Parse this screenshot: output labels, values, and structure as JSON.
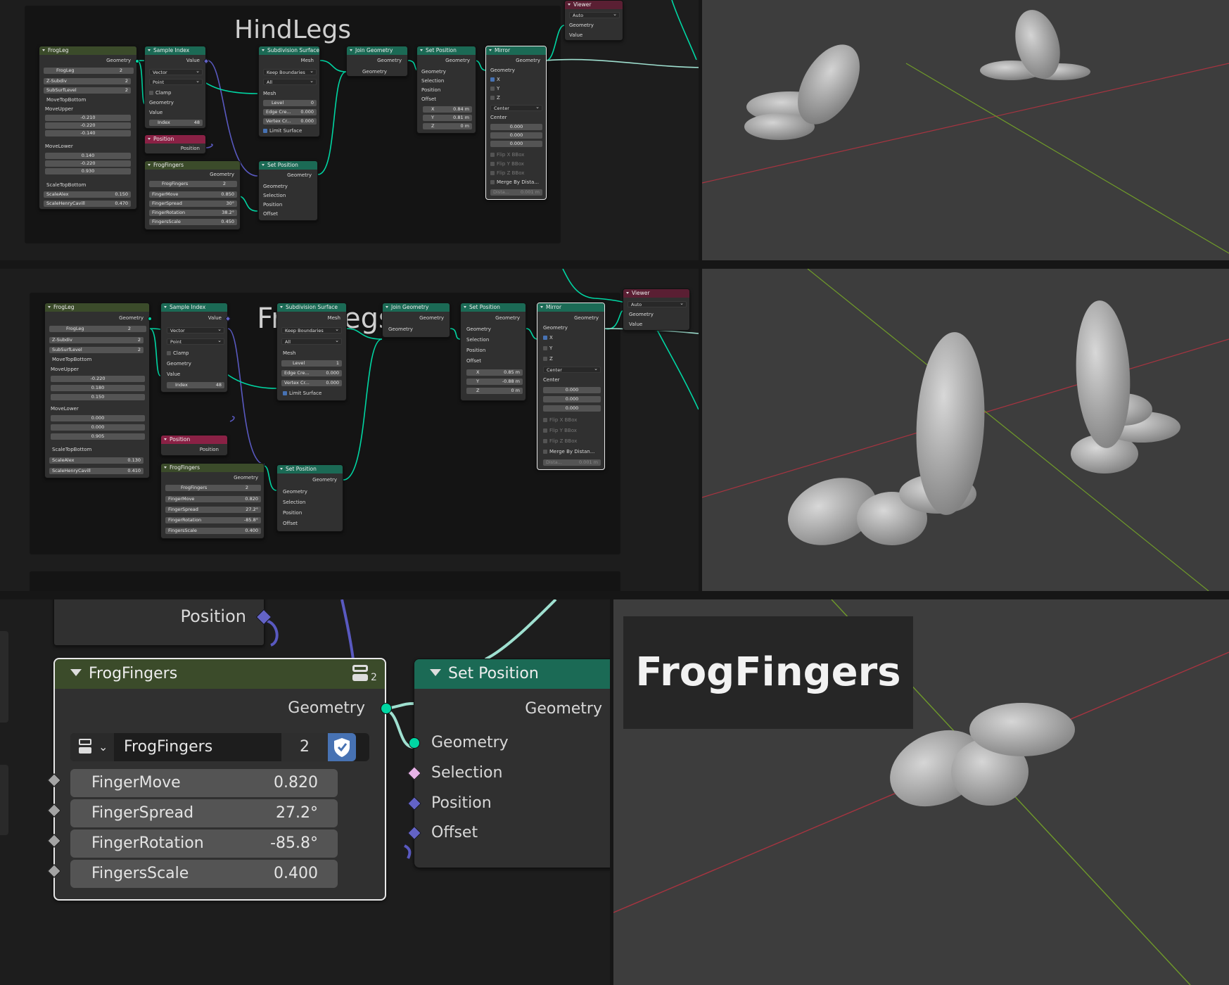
{
  "colors": {
    "geometry_socket": "#00d6a3",
    "group_header": "#3b4b2a",
    "geometry_header": "#1b6a55",
    "position_header": "#8a2145",
    "viewer_header": "#5a1f33",
    "vector_socket": "#6363c7",
    "float_socket": "#a3a3a3",
    "selection_socket": "#e8b3e8",
    "viewport_bg": "#3d3d3d",
    "x_axis": "#a73440",
    "y_axis": "#6f9a2a"
  },
  "hind": {
    "frame_title": "HindLegs",
    "frogleg": {
      "title": "FrogLeg",
      "out_geometry": "Geometry",
      "group_name": "FrogLeg",
      "users": "2",
      "z_subdiv_label": "Z-Subdiv",
      "z_subdiv": "2",
      "subsurf_label": "SubSurfLevel",
      "subsurf": "2",
      "move_top_bottom": "MoveTopBottom",
      "move_upper": "MoveUpper",
      "upper": [
        "-0.210",
        "-0.220",
        "-0.140"
      ],
      "move_lower": "MoveLower",
      "lower": [
        "0.140",
        "-0.220",
        "0.930"
      ],
      "scale_top_bottom": "ScaleTopBottom",
      "scale_alex_label": "ScaleAlex",
      "scale_alex": "0.150",
      "scale_henry_label": "ScaleHenryCavill",
      "scale_henry": "0.470"
    },
    "sample": {
      "title": "Sample Index",
      "out_value": "Value",
      "dd1": "Vector",
      "dd2": "Point",
      "clamp": "Clamp",
      "geometry": "Geometry",
      "value": "Value",
      "index_label": "Index",
      "index": "48"
    },
    "position": {
      "title": "Position",
      "out": "Position"
    },
    "fingers": {
      "title": "FrogFingers",
      "out_geometry": "Geometry",
      "group_name": "FrogFingers",
      "users": "2",
      "move_label": "FingerMove",
      "move": "0.850",
      "spread_label": "FingerSpread",
      "spread": "30°",
      "rotation_label": "FingerRotation",
      "rotation": "38.2°",
      "scale_label": "FingersScale",
      "scale": "0.450"
    },
    "subdiv": {
      "title": "Subdivision Surface",
      "out_mesh": "Mesh",
      "dd1": "Keep Boundaries",
      "dd2": "All",
      "mesh": "Mesh",
      "level_label": "Level",
      "level": "0",
      "edge_label": "Edge Cre...",
      "edge": "0.000",
      "vertex_label": "Vertex Cr...",
      "vertex": "0.000",
      "limit": "Limit Surface"
    },
    "setpos2": {
      "title": "Set Position",
      "out": "Geometry",
      "geometry": "Geometry",
      "selection": "Selection",
      "position": "Position",
      "offset": "Offset"
    },
    "join": {
      "title": "Join Geometry",
      "out": "Geometry",
      "geometry": "Geometry"
    },
    "setpos": {
      "title": "Set Position",
      "out": "Geometry",
      "geometry": "Geometry",
      "selection": "Selection",
      "position": "Position",
      "offset": "Offset",
      "x_label": "X",
      "x": "0.84 m",
      "y_label": "Y",
      "y": "0.81 m",
      "z_label": "Z",
      "z": "0 m"
    },
    "mirror": {
      "title": "Mirror",
      "out": "Geometry",
      "geometry": "Geometry",
      "x": "X",
      "y": "Y",
      "z": "Z",
      "mode": "Center",
      "center": "Center",
      "c": [
        "0.000",
        "0.000",
        "0.000"
      ],
      "flip_x": "Flip X BBox",
      "flip_y": "Flip Y BBox",
      "flip_z": "Flip Z BBox",
      "merge": "Merge By Dista...",
      "dist_label": "Dista...",
      "dist": "0.001 m"
    },
    "viewer": {
      "title": "Viewer",
      "mode": "Auto",
      "geometry": "Geometry",
      "value": "Value"
    }
  },
  "front": {
    "frame_title": "FrontLegs",
    "frogleg": {
      "title": "FrogLeg",
      "out_geometry": "Geometry",
      "group_name": "FrogLeg",
      "users": "2",
      "z_subdiv_label": "Z-Subdiv",
      "z_subdiv": "2",
      "subsurf_label": "SubSurfLevel",
      "subsurf": "2",
      "move_top_bottom": "MoveTopBottom",
      "move_upper": "MoveUpper",
      "upper": [
        "-0.220",
        "0.180",
        "0.150"
      ],
      "move_lower": "MoveLower",
      "lower": [
        "0.000",
        "0.000",
        "0.905"
      ],
      "scale_top_bottom": "ScaleTopBottom",
      "scale_alex_label": "ScaleAlex",
      "scale_alex": "0.130",
      "scale_henry_label": "ScaleHenryCavill",
      "scale_henry": "0.410"
    },
    "sample": {
      "title": "Sample Index",
      "out_value": "Value",
      "dd1": "Vector",
      "dd2": "Point",
      "clamp": "Clamp",
      "geometry": "Geometry",
      "value": "Value",
      "index_label": "Index",
      "index": "48"
    },
    "position": {
      "title": "Position",
      "out": "Position"
    },
    "fingers": {
      "title": "FrogFingers",
      "out_geometry": "Geometry",
      "group_name": "FrogFingers",
      "users": "2",
      "move_label": "FingerMove",
      "move": "0.820",
      "spread_label": "FingerSpread",
      "spread": "27.2°",
      "rotation_label": "FingerRotation",
      "rotation": "-85.8°",
      "scale_label": "FingersScale",
      "scale": "0.400"
    },
    "subdiv": {
      "title": "Subdivision Surface",
      "out_mesh": "Mesh",
      "dd1": "Keep Boundaries",
      "dd2": "All",
      "mesh": "Mesh",
      "level_label": "Level",
      "level": "1",
      "edge_label": "Edge Cre...",
      "edge": "0.000",
      "vertex_label": "Vertex Cr...",
      "vertex": "0.000",
      "limit": "Limit Surface"
    },
    "setpos2": {
      "title": "Set Position",
      "out": "Geometry",
      "geometry": "Geometry",
      "selection": "Selection",
      "position": "Position",
      "offset": "Offset"
    },
    "join": {
      "title": "Join Geometry",
      "out": "Geometry",
      "geometry": "Geometry"
    },
    "setpos": {
      "title": "Set Position",
      "out": "Geometry",
      "geometry": "Geometry",
      "selection": "Selection",
      "position": "Position",
      "offset": "Offset",
      "x_label": "X",
      "x": "0.85 m",
      "y_label": "Y",
      "y": "-0.88 m",
      "z_label": "Z",
      "z": "0 m"
    },
    "mirror": {
      "title": "Mirror",
      "out": "Geometry",
      "geometry": "Geometry",
      "x": "X",
      "y": "Y",
      "z": "Z",
      "mode": "Center",
      "center": "Center",
      "c": [
        "0.000",
        "0.000",
        "0.000"
      ],
      "flip_x": "Flip X BBox",
      "flip_y": "Flip Y BBox",
      "flip_z": "Flip Z BBox",
      "merge": "Merge By Distan...",
      "dist_label": "Dista...",
      "dist": "0.001 m"
    },
    "viewer": {
      "title": "Viewer",
      "mode": "Auto",
      "geometry": "Geometry",
      "value": "Value"
    }
  },
  "zoom": {
    "position_out": "Position",
    "fingers": {
      "title": "FrogFingers",
      "users": "2",
      "out_geometry": "Geometry",
      "group_name": "FrogFingers",
      "count": "2",
      "move_label": "FingerMove",
      "move": "0.820",
      "spread_label": "FingerSpread",
      "spread": "27.2°",
      "rotation_label": "FingerRotation",
      "rotation": "-85.8°",
      "scale_label": "FingersScale",
      "scale": "0.400"
    },
    "setpos": {
      "title": "Set Position",
      "out": "Geometry",
      "geometry": "Geometry",
      "selection": "Selection",
      "position": "Position",
      "offset": "Offset"
    },
    "viewport_label": "FrogFingers"
  }
}
